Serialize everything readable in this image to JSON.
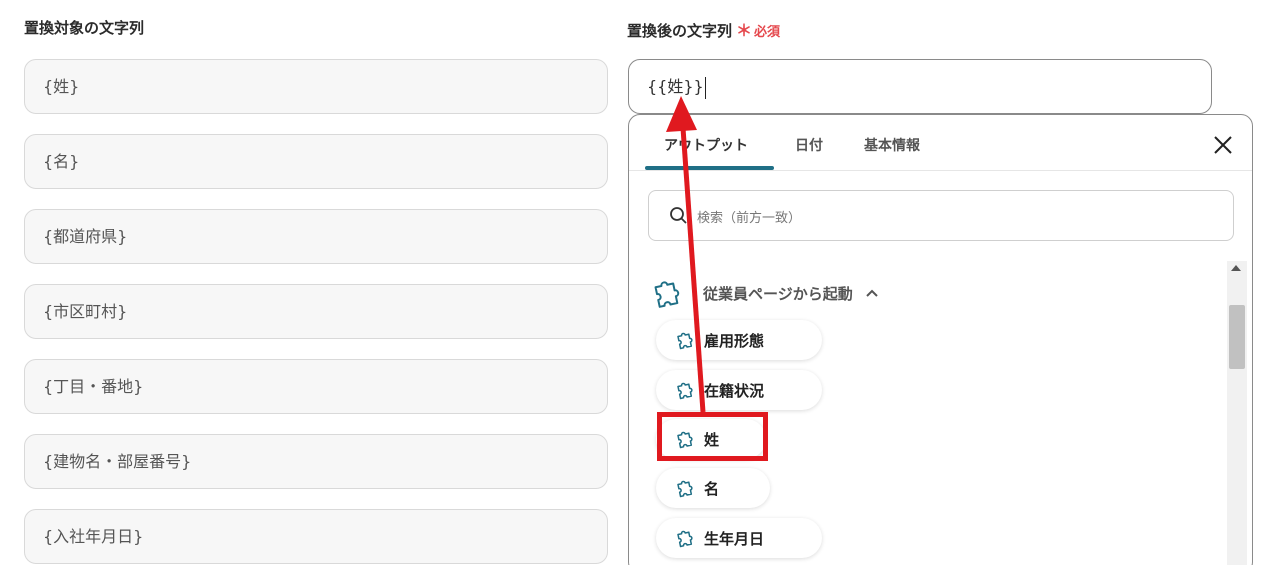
{
  "left_column": {
    "label": "置換対象の文字列",
    "fields": [
      "{姓}",
      "{名}",
      "{都道府県}",
      "{市区町村}",
      "{丁目・番地}",
      "{建物名・部屋番号}",
      "{入社年月日}"
    ]
  },
  "right_column": {
    "label": "置換後の文字列",
    "required_star": "＊",
    "required_text": "必須",
    "input_value": "{{姓}}"
  },
  "popup": {
    "tabs": [
      "アウトプット",
      "日付",
      "基本情報"
    ],
    "active_tab": "アウトプット",
    "search_placeholder": "検索（前方一致）",
    "group": {
      "title": "従業員ページから起動",
      "items": [
        "雇用形態",
        "在籍状況",
        "姓",
        "名",
        "生年月日"
      ]
    },
    "highlighted_item": "姓"
  },
  "colors": {
    "accent": "#1f6f86",
    "required": "#e5484d",
    "annotation_red": "#e0191f"
  },
  "icons": [
    "puzzle-icon",
    "search-icon",
    "close-icon",
    "chevron-up-icon"
  ]
}
